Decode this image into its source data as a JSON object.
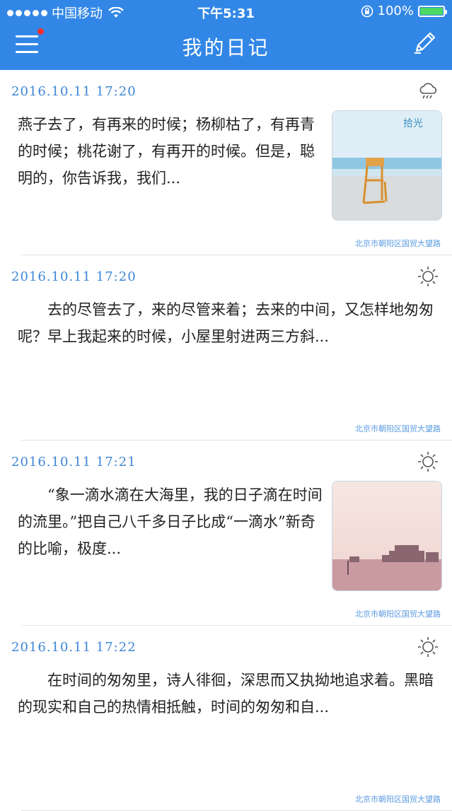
{
  "status_bar": {
    "carrier": "中国移动",
    "time": "下午5:31",
    "battery": "100%",
    "battery_level": 1.0
  },
  "nav": {
    "title": "我的日记",
    "menu_icon": "hamburger-menu-icon",
    "edit_icon": "pencil-icon"
  },
  "entries": [
    {
      "date": "2016.10.11  17:20",
      "weather": "cloudy-rain-icon",
      "text": "燕子去了，有再来的时候；杨柳枯了，有再青的时候；桃花谢了，有再开的时候。但是，聪明的，你告诉我，我们...",
      "image_text": "拾光",
      "location": "北京市朝阳区国贸大望路"
    },
    {
      "date": "2016.10.11  17:20",
      "weather": "sun-icon",
      "text": "　　去的尽管去了，来的尽管来着；去来的中间，又怎样地匆匆呢？早上我起来的时候，小屋里射进两三方斜...",
      "location": "北京市朝阳区国贸大望路"
    },
    {
      "date": "2016.10.11  17:21",
      "weather": "sun-icon",
      "text": "　　“象一滴水滴在大海里，我的日子滴在时间的流里。”把自己八千多日子比成“一滴水”新奇的比喻，极度...",
      "location": "北京市朝阳区国贸大望路"
    },
    {
      "date": "2016.10.11  17:22",
      "weather": "sun-icon",
      "text": "　　在时间的匆匆里，诗人徘徊，深思而又执拗地追求着。黑暗的现实和自己的热情相抵触，时间的匆匆和自...",
      "location": "北京市朝阳区国贸大望路"
    }
  ]
}
